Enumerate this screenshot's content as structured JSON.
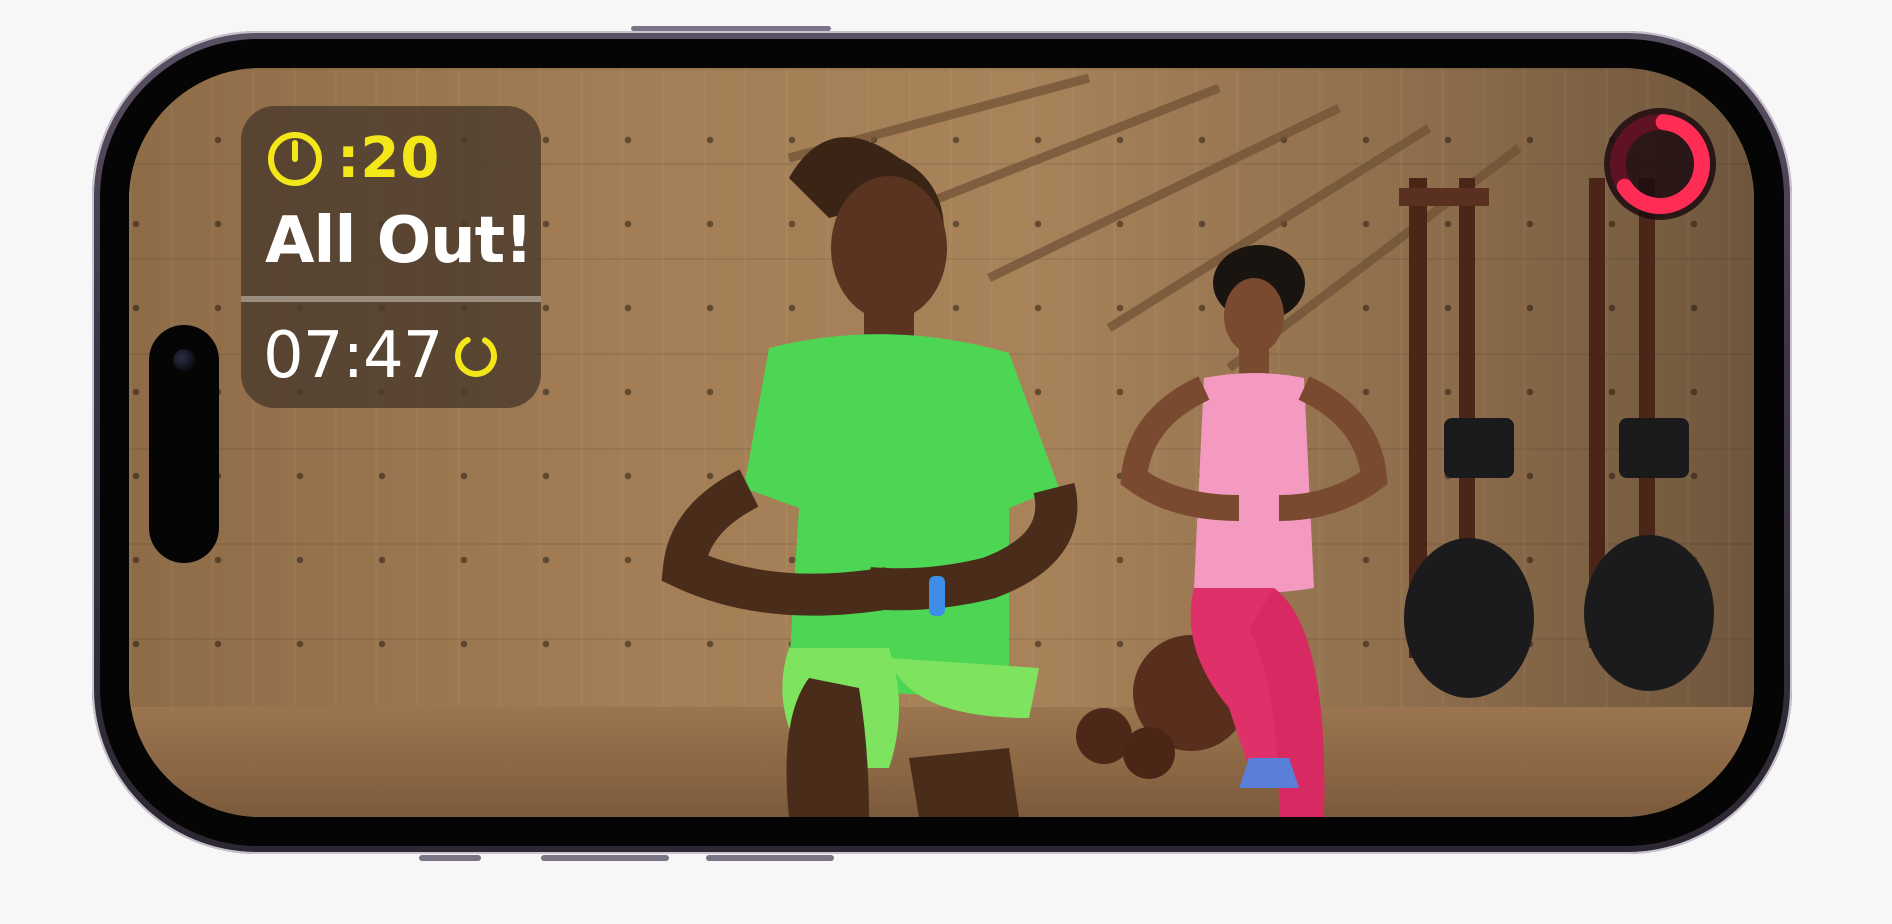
{
  "workout": {
    "interval_time": ":20",
    "status": "All Out!",
    "elapsed_time": "07:47"
  },
  "colors": {
    "accent_yellow": "#f3e71a",
    "move_ring_red": "#ff2d55"
  },
  "icons": {
    "stopwatch": "stopwatch-icon",
    "interval_progress": "progress-ring-icon",
    "activity": "activity-ring-icon"
  }
}
